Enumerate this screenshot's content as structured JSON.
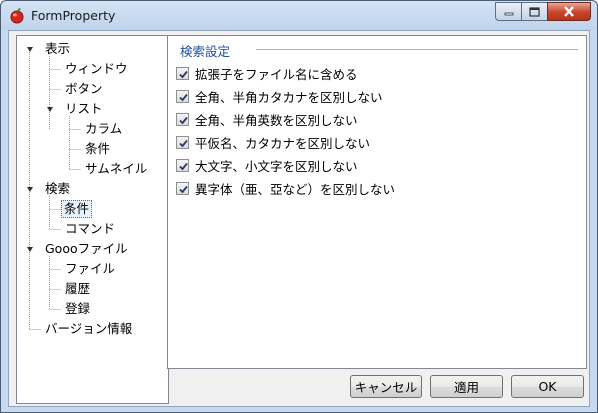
{
  "window": {
    "title": "FormProperty"
  },
  "tree": {
    "items": [
      {
        "label": "表示"
      },
      {
        "label": "ウィンドウ"
      },
      {
        "label": "ボタン"
      },
      {
        "label": "リスト"
      },
      {
        "label": "カラム"
      },
      {
        "label": "条件"
      },
      {
        "label": "サムネイル"
      },
      {
        "label": "検索"
      },
      {
        "label": "条件"
      },
      {
        "label": "コマンド"
      },
      {
        "label": "Goooファイル"
      },
      {
        "label": "ファイル"
      },
      {
        "label": "履歴"
      },
      {
        "label": "登録"
      },
      {
        "label": "バージョン情報"
      }
    ],
    "selected": "検索 / 条件"
  },
  "search_settings": {
    "group_title": "検索設定",
    "options": [
      {
        "label": "拡張子をファイル名に含める",
        "checked": true
      },
      {
        "label": "全角、半角カタカナを区別しない",
        "checked": true
      },
      {
        "label": "全角、半角英数を区別しない",
        "checked": true
      },
      {
        "label": "平仮名、カタカナを区別しない",
        "checked": true
      },
      {
        "label": "大文字、小文字を区別しない",
        "checked": true
      },
      {
        "label": "異字体（亜、亞など）を区別しない",
        "checked": true
      }
    ]
  },
  "buttons": {
    "cancel": "キャンセル",
    "apply": "適用",
    "ok": "OK"
  },
  "colors": {
    "title_bar": "#c7d9ee",
    "close_button": "#c8442a",
    "group_title": "#1e50a2",
    "selection_border": "#3a6fb0"
  }
}
